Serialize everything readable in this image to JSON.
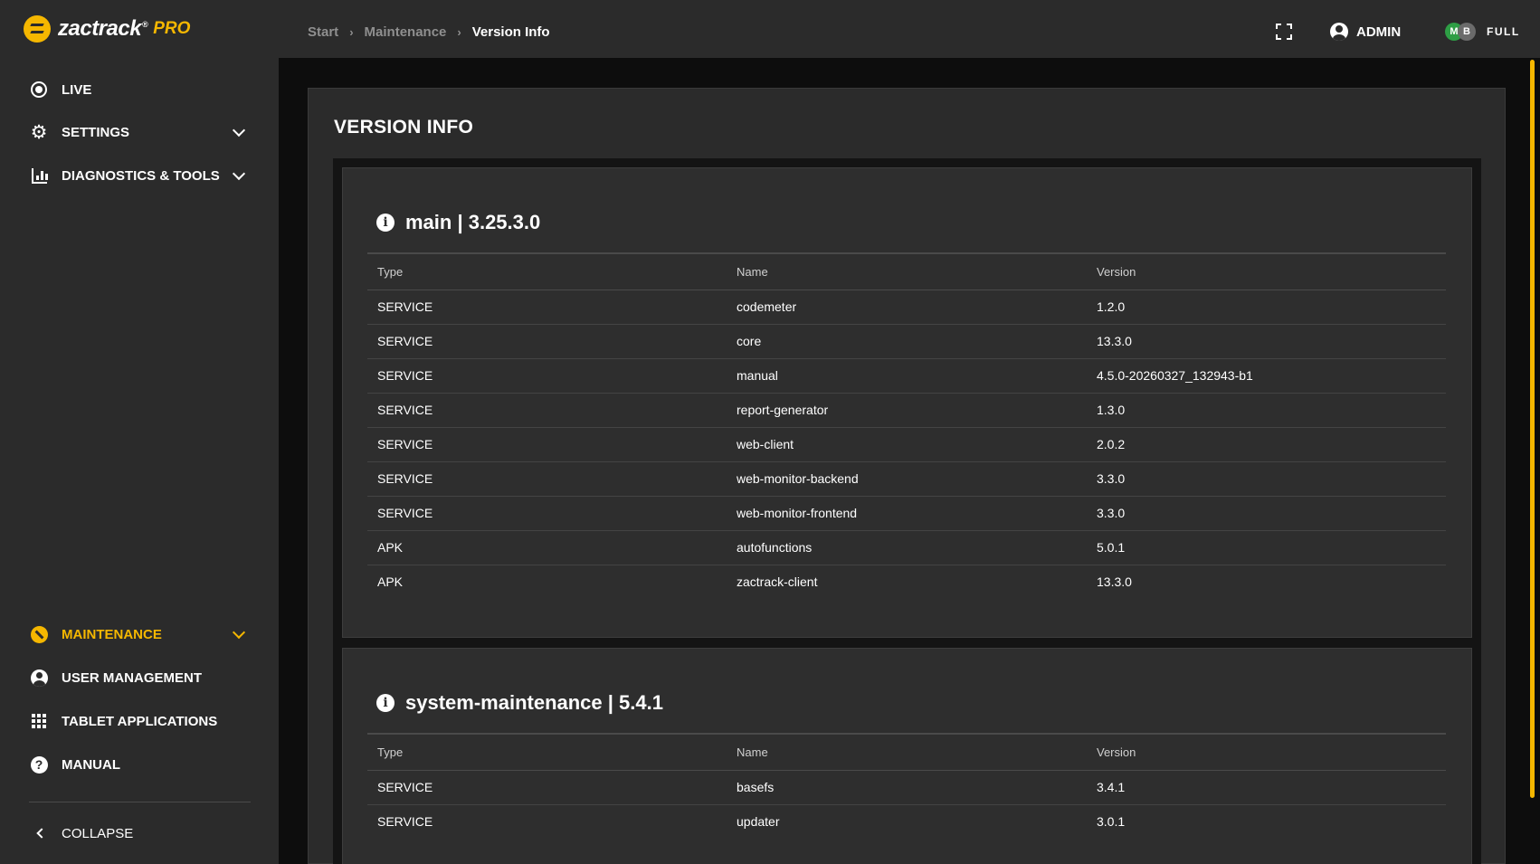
{
  "header": {
    "brand": "zactrack",
    "brand_mark": "®",
    "brand_edition": "PRO",
    "breadcrumb": [
      "Start",
      "Maintenance",
      "Version Info"
    ],
    "user_label": "ADMIN",
    "status_badges": [
      "M",
      "B"
    ],
    "status_label": "FULL"
  },
  "sidebar": {
    "items": [
      {
        "label": "LIVE",
        "icon": "live-icon"
      },
      {
        "label": "SETTINGS",
        "icon": "gear-icon"
      },
      {
        "label": "DIAGNOSTICS & TOOLS",
        "icon": "chart-icon"
      },
      {
        "label": "MAINTENANCE",
        "icon": "wrench-icon",
        "active": true
      },
      {
        "label": "USER MANAGEMENT",
        "icon": "account-icon"
      },
      {
        "label": "TABLET APPLICATIONS",
        "icon": "apps-grid-icon"
      },
      {
        "label": "MANUAL",
        "icon": "help-icon"
      }
    ],
    "collapse_label": "COLLAPSE"
  },
  "page": {
    "title": "VERSION INFO",
    "columns": [
      "Type",
      "Name",
      "Version"
    ],
    "sections": [
      {
        "title": "main | 3.25.3.0",
        "rows": [
          [
            "SERVICE",
            "codemeter",
            "1.2.0"
          ],
          [
            "SERVICE",
            "core",
            "13.3.0"
          ],
          [
            "SERVICE",
            "manual",
            "4.5.0-20260327_132943-b1"
          ],
          [
            "SERVICE",
            "report-generator",
            "1.3.0"
          ],
          [
            "SERVICE",
            "web-client",
            "2.0.2"
          ],
          [
            "SERVICE",
            "web-monitor-backend",
            "3.3.0"
          ],
          [
            "SERVICE",
            "web-monitor-frontend",
            "3.3.0"
          ],
          [
            "APK",
            "autofunctions",
            "5.0.1"
          ],
          [
            "APK",
            "zactrack-client",
            "13.3.0"
          ]
        ]
      },
      {
        "title": "system-maintenance | 5.4.1",
        "rows": [
          [
            "SERVICE",
            "basefs",
            "3.4.1"
          ],
          [
            "SERVICE",
            "updater",
            "3.0.1"
          ]
        ]
      }
    ]
  },
  "colors": {
    "accent": "#f5b700",
    "surface": "#2b2b2b",
    "background": "#0d0d0d",
    "status_green": "#2e9e45"
  }
}
